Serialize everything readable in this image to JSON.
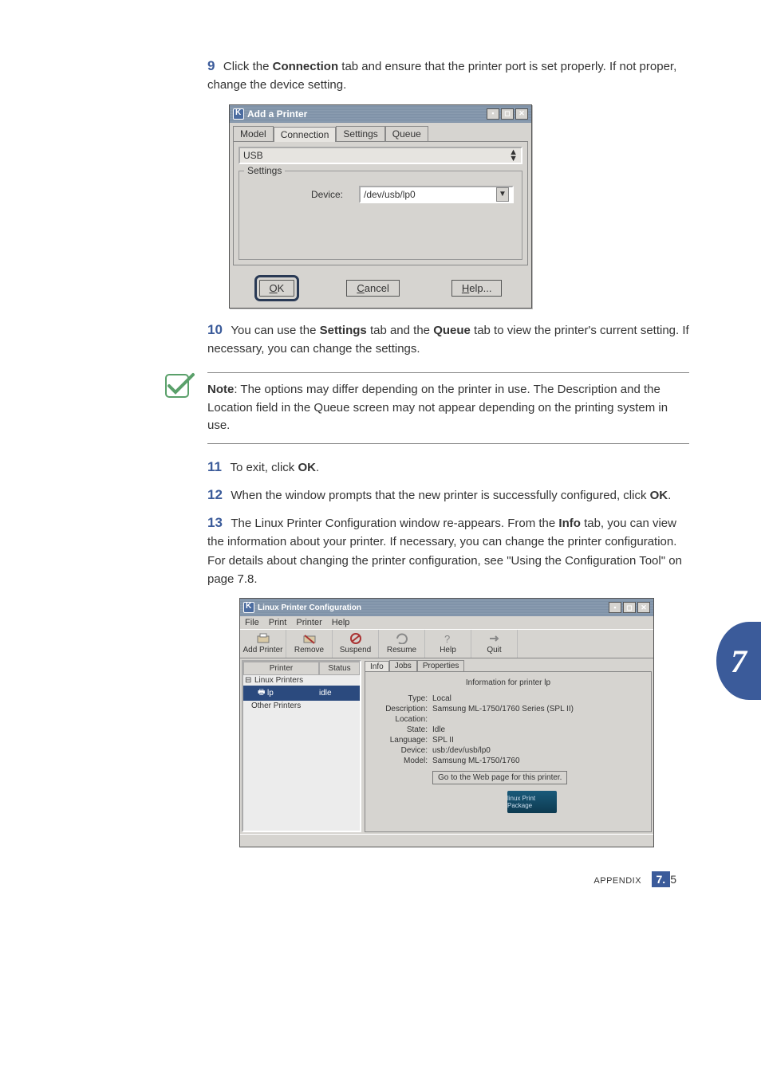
{
  "steps": {
    "s9": {
      "num": "9",
      "text_a": "Click the ",
      "bold_a": "Connection",
      "text_b": " tab and ensure that the printer port is set properly. If not proper, change the device setting."
    },
    "s10": {
      "num": "10",
      "text_a": "You can use the ",
      "bold_a": "Settings",
      "text_b": " tab and the ",
      "bold_b": "Queue",
      "text_c": " tab to view the printer's current setting. If necessary, you can change the settings."
    },
    "s11": {
      "num": "11",
      "text_a": "To exit, click ",
      "bold_a": "OK",
      "text_b": "."
    },
    "s12": {
      "num": "12",
      "text_a": "When the window prompts that the new printer is successfully configured, click ",
      "bold_a": "OK",
      "text_b": "."
    },
    "s13": {
      "num": "13",
      "text": "The Linux Printer Configuration window re-appears. From the ",
      "bold_a": "Info",
      "text_b": " tab, you can view the information about your printer. If necessary, you can change the printer configuration. For details about changing the printer configuration, see \"Using the Configuration Tool\" on page 7.8."
    }
  },
  "note": {
    "label": "Note",
    "text": ": The options may differ depending on the printer in use. The Description and the Location field in the Queue screen may not appear depending on the printing system in use."
  },
  "add_printer": {
    "title": "Add a Printer",
    "tabs": {
      "model": "Model",
      "connection": "Connection",
      "settings": "Settings",
      "queue": "Queue"
    },
    "type_value": "USB",
    "settings_legend": "Settings",
    "device_label": "Device:",
    "device_value": "/dev/usb/lp0",
    "ok": "OK",
    "cancel": "Cancel",
    "help": "Help..."
  },
  "lpc": {
    "title": "Linux Printer Configuration",
    "menus": {
      "file": "File",
      "print": "Print",
      "printer_m": "Printer",
      "help_m": "Help"
    },
    "tools": {
      "add": "Add Printer",
      "remove": "Remove",
      "suspend": "Suspend",
      "resume": "Resume",
      "help": "Help",
      "quit": "Quit"
    },
    "tree": {
      "col_printer": "Printer",
      "col_status": "Status",
      "root": "Linux Printers",
      "item": "lp",
      "item_status": "idle",
      "other": "Other Printers"
    },
    "info_tabs": {
      "info": "Info",
      "jobs": "Jobs",
      "props": "Properties"
    },
    "info_title": "Information for printer lp",
    "kv": {
      "type_k": "Type:",
      "type_v": "Local",
      "desc_k": "Description:",
      "desc_v": "Samsung ML-1750/1760 Series (SPL II)",
      "loc_k": "Location:",
      "loc_v": "",
      "state_k": "State:",
      "state_v": "Idle",
      "lang_k": "Language:",
      "lang_v": "SPL II",
      "dev_k": "Device:",
      "dev_v": "usb:/dev/usb/lp0",
      "model_k": "Model:",
      "model_v": "Samsung ML-1750/1760"
    },
    "web_btn": "Go to the Web page for this printer.",
    "lpp": "linux Print Package"
  },
  "chapter": "7",
  "footer": {
    "appendix": "APPENDIX",
    "page_major": "7.",
    "page_minor": "5"
  }
}
